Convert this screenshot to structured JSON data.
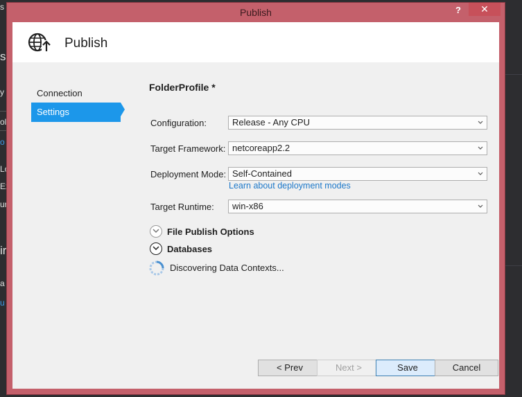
{
  "background": {
    "left_fragments": [
      "s",
      "sl",
      "y",
      "ol",
      "o",
      "Lo",
      "Ex",
      "ur",
      "ir",
      "a",
      "u"
    ]
  },
  "dialog": {
    "title": "Publish",
    "help_label": "?",
    "close_label": "✕",
    "header_title": "Publish",
    "header_icon": "globe-publish-icon"
  },
  "nav": {
    "items": [
      {
        "label": "Connection",
        "selected": false
      },
      {
        "label": "Settings",
        "selected": true
      }
    ]
  },
  "settings": {
    "profile_title": "FolderProfile *",
    "configuration": {
      "label": "Configuration:",
      "value": "Release - Any CPU"
    },
    "target_framework": {
      "label": "Target Framework:",
      "value": "netcoreapp2.2"
    },
    "deployment_mode": {
      "label": "Deployment Mode:",
      "value": "Self-Contained"
    },
    "deployment_link": "Learn about deployment modes",
    "target_runtime": {
      "label": "Target Runtime:",
      "value": "win-x86"
    },
    "sections": {
      "file_publish_options": "File Publish Options",
      "databases": "Databases"
    },
    "progress_text": "Discovering Data Contexts..."
  },
  "buttons": {
    "prev": "< Prev",
    "next": "Next >",
    "save": "Save",
    "cancel": "Cancel"
  },
  "colors": {
    "accent": "#1c97ea",
    "frame": "#c4606b",
    "link": "#1c78c9"
  }
}
